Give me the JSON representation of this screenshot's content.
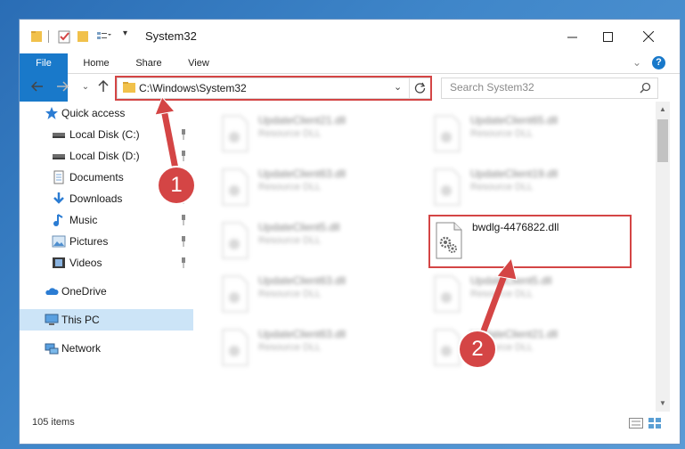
{
  "window": {
    "title": "System32"
  },
  "ribbon": {
    "tabs": [
      "File",
      "Home",
      "Share",
      "View"
    ]
  },
  "address": {
    "path": "C:\\Windows\\System32"
  },
  "search": {
    "placeholder": "Search System32"
  },
  "sidebar": {
    "items": [
      {
        "label": "Quick access",
        "icon": "star-icon"
      },
      {
        "label": "Local Disk (C:)",
        "icon": "drive-icon",
        "pinned": true
      },
      {
        "label": "Local Disk (D:)",
        "icon": "drive-icon",
        "pinned": true
      },
      {
        "label": "Documents",
        "icon": "documents-icon",
        "pinned": true
      },
      {
        "label": "Downloads",
        "icon": "download-icon",
        "pinned": true
      },
      {
        "label": "Music",
        "icon": "music-icon",
        "pinned": true
      },
      {
        "label": "Pictures",
        "icon": "pictures-icon",
        "pinned": true
      },
      {
        "label": "Videos",
        "icon": "videos-icon",
        "pinned": true
      },
      {
        "label": "OneDrive",
        "icon": "cloud-icon"
      },
      {
        "label": "This PC",
        "icon": "pc-icon",
        "selected": true
      },
      {
        "label": "Network",
        "icon": "network-icon"
      }
    ]
  },
  "files": [
    {
      "name": "UpdateClient21.dll",
      "type": "Resource DLL",
      "blurred": true
    },
    {
      "name": "UpdateClient65.dll",
      "type": "Resource DLL",
      "blurred": true
    },
    {
      "name": "UpdateClient63.dll",
      "type": "Resource DLL",
      "blurred": true
    },
    {
      "name": "UpdateClient19.dll",
      "type": "Resource DLL",
      "blurred": true
    },
    {
      "name": "UpdateClient5.dll",
      "type": "Resource DLL",
      "blurred": true
    },
    {
      "name": "bwdlg-4476822.dll",
      "type": "",
      "blurred": false
    },
    {
      "name": "UpdateClient63.dll",
      "type": "Resource DLL",
      "blurred": true
    },
    {
      "name": "UpdateClient5.dll",
      "type": "Resource DLL",
      "blurred": true
    },
    {
      "name": "UpdateClient63.dll",
      "type": "Resource DLL",
      "blurred": true
    },
    {
      "name": "UpdateClient21.dll",
      "type": "Resource DLL",
      "blurred": true
    }
  ],
  "status": {
    "item_count": "105 items"
  },
  "annotations": {
    "step1": "1",
    "step2": "2"
  },
  "colors": {
    "accent": "#1979ca",
    "highlight": "#d44545",
    "selected": "#cce4f7"
  }
}
